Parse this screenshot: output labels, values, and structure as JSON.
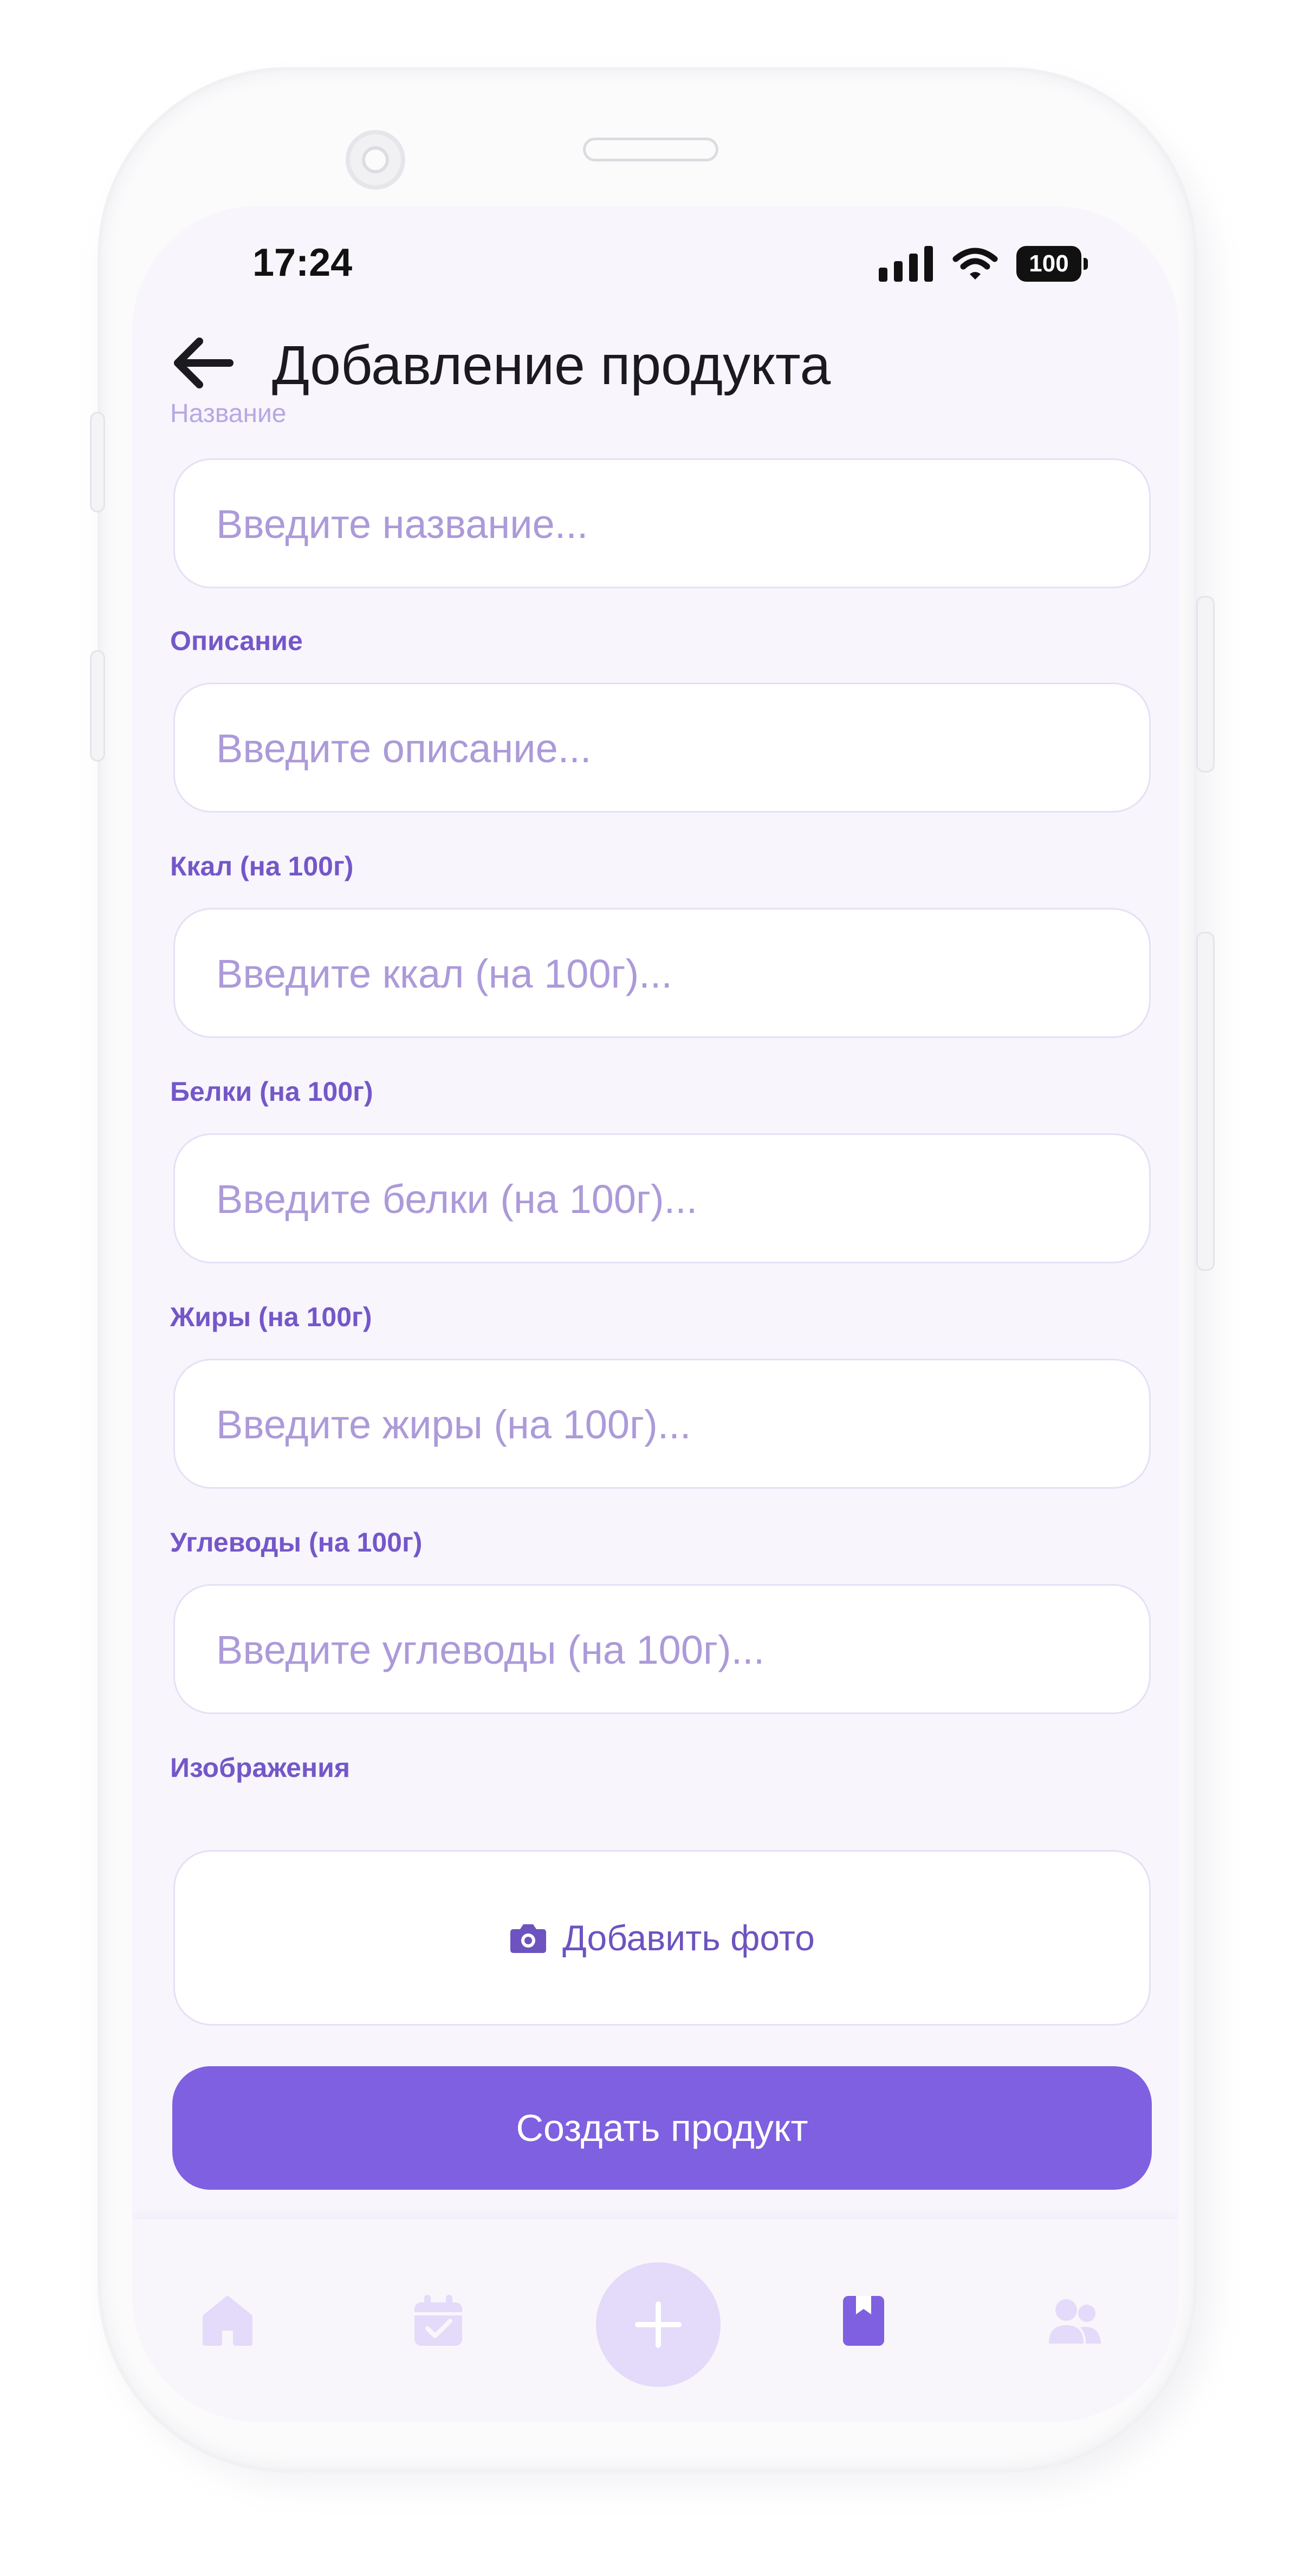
{
  "status_bar": {
    "time": "17:24",
    "battery": "100",
    "icons": [
      "signal-icon",
      "wifi-icon",
      "battery-icon"
    ]
  },
  "header": {
    "title": "Добавление продукта",
    "back_icon": "arrow-left-icon"
  },
  "form": {
    "fields": [
      {
        "label": "Название",
        "placeholder": "Введите название...",
        "value": ""
      },
      {
        "label": "Описание",
        "placeholder": "Введите описание...",
        "value": ""
      },
      {
        "label": "Ккал (на 100г)",
        "placeholder": "Введите ккал (на 100г)...",
        "value": ""
      },
      {
        "label": "Белки (на 100г)",
        "placeholder": "Введите белки (на 100г)...",
        "value": ""
      },
      {
        "label": "Жиры (на 100г)",
        "placeholder": "Введите жиры (на 100г)...",
        "value": ""
      },
      {
        "label": "Углеводы (на 100г)",
        "placeholder": "Введите углеводы (на 100г)...",
        "value": ""
      }
    ],
    "images": {
      "label": "Изображения",
      "add_photo_label": "Добавить фото",
      "icon": "camera-icon"
    },
    "submit_label": "Создать продукт"
  },
  "bottom_nav": {
    "items": [
      {
        "icon": "home-icon",
        "active": false
      },
      {
        "icon": "calendar-check-icon",
        "active": false
      },
      {
        "icon": "plus-icon",
        "active": false
      },
      {
        "icon": "bookmark-icon",
        "active": true
      },
      {
        "icon": "users-icon",
        "active": false
      }
    ]
  },
  "colors": {
    "accent": "#7E60E0",
    "label": "#7457C8",
    "placeholder": "#AC9AD9",
    "screen_background": "#F8F5FD",
    "nav_inactive": "#E4DAF9"
  }
}
